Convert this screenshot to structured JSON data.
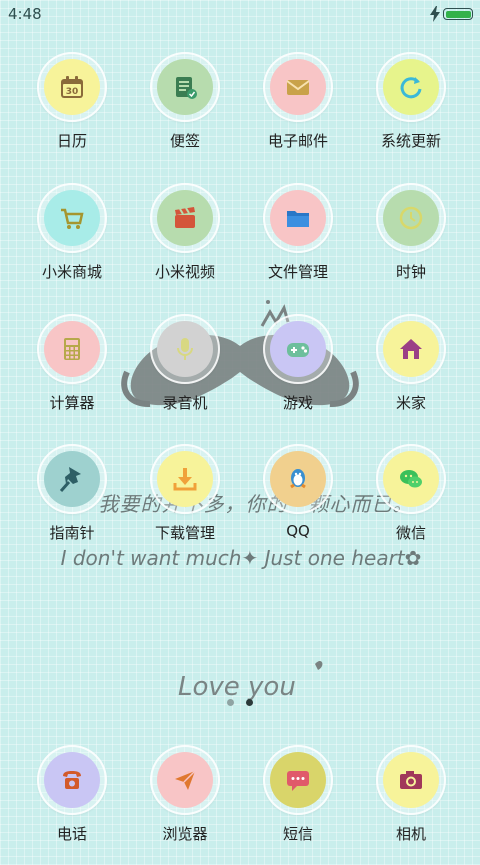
{
  "status": {
    "time": "4:48",
    "battery": "charging"
  },
  "wallpaper": {
    "line1": "我要的并不多，你的一颗心而已。",
    "line2": "I don't want much✦ Just one heart✿",
    "love": "Love you"
  },
  "apps": [
    {
      "label": "日历",
      "icon": "calendar-icon",
      "bg": "#f7f39a",
      "glyph": "30"
    },
    {
      "label": "便签",
      "icon": "notes-icon",
      "bg": "#b7dcae"
    },
    {
      "label": "电子邮件",
      "icon": "mail-icon",
      "bg": "#f8c5c6"
    },
    {
      "label": "系统更新",
      "icon": "refresh-icon",
      "bg": "#e7f48c"
    },
    {
      "label": "小米商城",
      "icon": "cart-icon",
      "bg": "#a8ece8"
    },
    {
      "label": "小米视频",
      "icon": "video-icon",
      "bg": "#b7dcae"
    },
    {
      "label": "文件管理",
      "icon": "folder-icon",
      "bg": "#f8c5c6"
    },
    {
      "label": "时钟",
      "icon": "clock-icon",
      "bg": "#b7dcae"
    },
    {
      "label": "计算器",
      "icon": "calculator-icon",
      "bg": "#f8c5c6"
    },
    {
      "label": "录音机",
      "icon": "microphone-icon",
      "bg": "#d2d2d2"
    },
    {
      "label": "游戏",
      "icon": "gamepad-icon",
      "bg": "#c9c6f4"
    },
    {
      "label": "米家",
      "icon": "home-icon",
      "bg": "#f7f39a"
    },
    {
      "label": "指南针",
      "icon": "pin-icon",
      "bg": "#9ed1cf"
    },
    {
      "label": "下载管理",
      "icon": "download-icon",
      "bg": "#f7f39a"
    },
    {
      "label": "QQ",
      "icon": "qq-penguin-icon",
      "bg": "#f1d08e"
    },
    {
      "label": "微信",
      "icon": "wechat-icon",
      "bg": "#f7f39a"
    }
  ],
  "dock": [
    {
      "label": "电话",
      "icon": "phone-icon",
      "bg": "#c9c6f4"
    },
    {
      "label": "浏览器",
      "icon": "browser-icon",
      "bg": "#f8c5c6"
    },
    {
      "label": "短信",
      "icon": "message-icon",
      "bg": "#d9d56a"
    },
    {
      "label": "相机",
      "icon": "camera-icon",
      "bg": "#f7f39a"
    }
  ],
  "pages": {
    "count": 2,
    "current": 2
  }
}
